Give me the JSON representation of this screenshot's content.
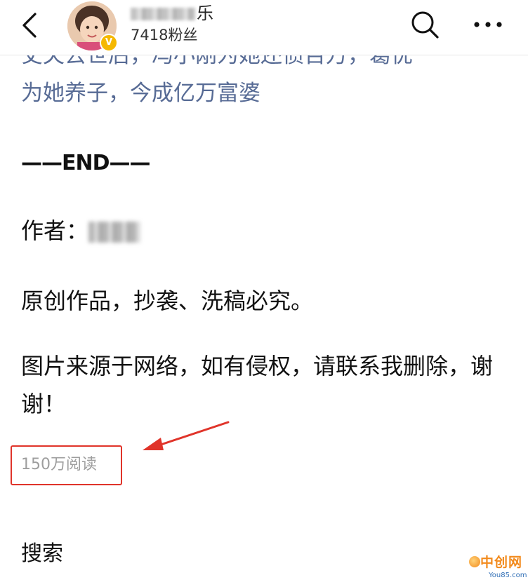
{
  "header": {
    "back_icon": "chevron-left-icon",
    "account_name_visible_part": "乐",
    "followers": "7418粉丝",
    "verified_badge": "V",
    "search_icon": "search-icon",
    "more_icon": "more-icon"
  },
  "article": {
    "related_link_line1": "丈夫去世后，冯小刚为她还债百万，葛优",
    "related_link_line2": "为她养子，今成亿万富婆",
    "end_mark": "——END——",
    "author_label": "作者：",
    "original_notice": "原创作品，抄袭、洗稿必究。",
    "image_source_notice": "图片来源于网络，如有侵权，请联系我删除，谢谢！",
    "read_count": "150万阅读",
    "search_label": "搜索"
  },
  "watermark": {
    "main": "中创网",
    "sub": "You85.com"
  },
  "colors": {
    "link": "#576b95",
    "highlight_box": "#e0342a",
    "annotation_arrow": "#e0342a",
    "read_count": "#9e9e9e",
    "badge": "#f5b800"
  }
}
